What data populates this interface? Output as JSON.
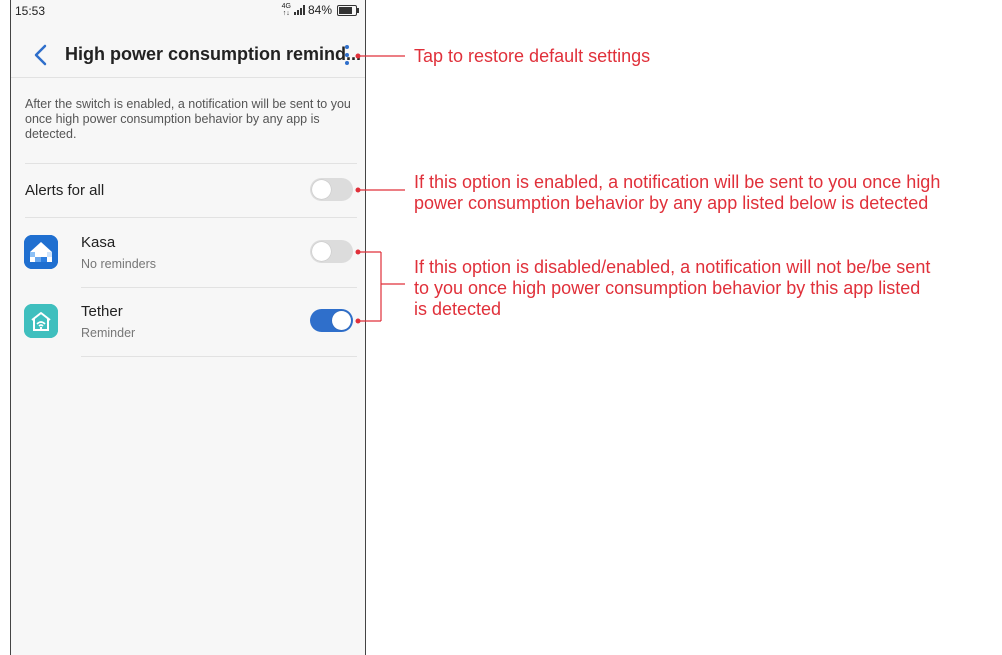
{
  "status_bar": {
    "time": "15:53",
    "network_top": "4G",
    "network_bottom": "↑↓",
    "battery": "84%"
  },
  "header": {
    "title": "High power consumption remind...",
    "back_icon": "chevron-left-icon",
    "more_icon": "more-vertical-icon"
  },
  "description": "After the switch is enabled, a notification will be sent to you once high power consumption behavior by any app is detected.",
  "alerts_for_all": {
    "label": "Alerts for all",
    "enabled": false
  },
  "apps": [
    {
      "name": "Kasa",
      "status": "No reminders",
      "enabled": false,
      "icon": "kasa-house-icon",
      "icon_color": "#1f6fd0"
    },
    {
      "name": "Tether",
      "status": "Reminder",
      "enabled": true,
      "icon": "tether-router-icon",
      "icon_color": "#3fbfbe"
    }
  ],
  "annotations": {
    "menu": "Tap to restore default settings",
    "alerts_all_line1": "If this option is enabled, a notification will be sent to you once high",
    "alerts_all_line2": "power consumption behavior by any app listed below is detected",
    "per_app_line1": "If this option is disabled/enabled, a notification will not be/be sent",
    "per_app_line2": "to you once high power consumption behavior by this app listed",
    "per_app_line3": "is detected"
  },
  "colors": {
    "accent": "#2f6fcb",
    "annotation": "#e0303a",
    "toggle_off": "#dcdcdc"
  }
}
